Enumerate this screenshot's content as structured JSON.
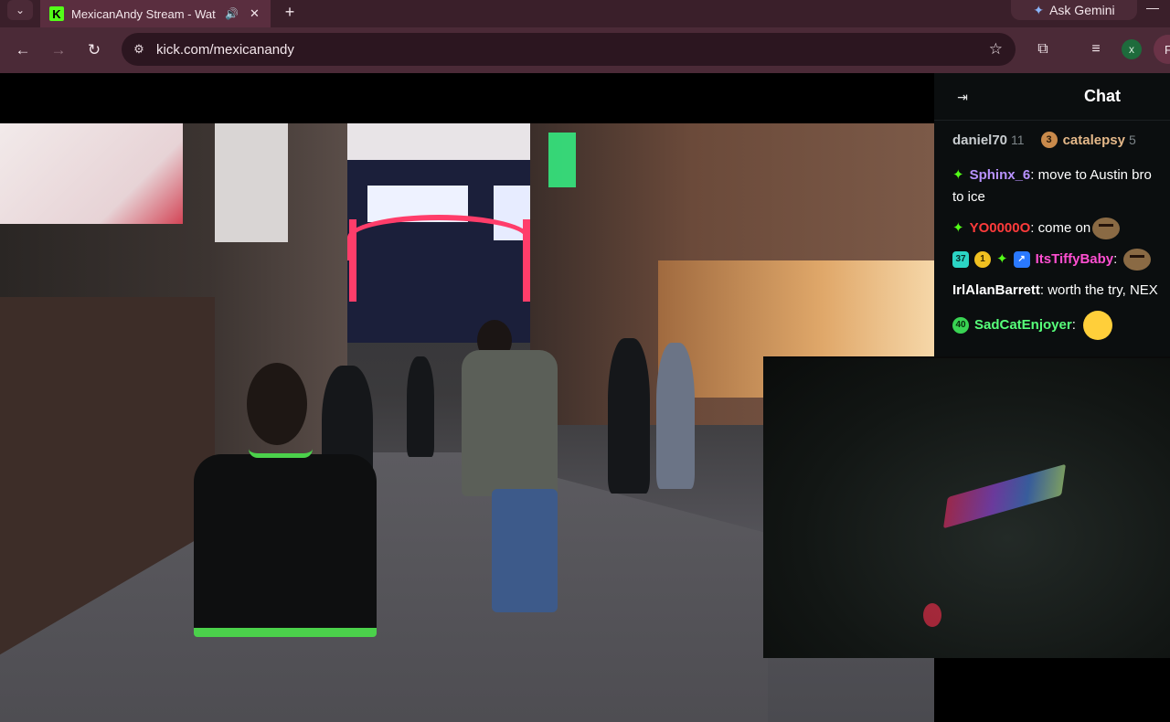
{
  "browser": {
    "tab_title": "MexicanAndy Stream - Wat",
    "favicon_letter": "K",
    "url": "kick.com/mexicanandy",
    "gemini_label": "Ask Gemini",
    "profile_x": "x",
    "profile_f": "F"
  },
  "colors": {
    "kick_green": "#53fc18",
    "chrome_bg": "#4b2a37",
    "tab_strip": "#3a1f2a"
  },
  "chat": {
    "title": "Chat",
    "leaderboard": [
      {
        "name": "daniel70",
        "count": "11"
      },
      {
        "rank": "3",
        "name": "catalepsy",
        "count": "5"
      }
    ],
    "messages": [
      {
        "user": "Sphinx_6",
        "user_color": "#b892ff",
        "text": "move to Austin bro",
        "continuation": "to ice"
      },
      {
        "user": "YO0000O",
        "user_color": "#ff3b3b",
        "text": "come on"
      },
      {
        "badges": [
          "37",
          "1"
        ],
        "user": "ItsTiffyBaby",
        "user_color": "#ff4fd1",
        "text": ""
      },
      {
        "user": "IrlAlanBarrett",
        "user_color": "#ffffff",
        "text": "worth the try, NEX"
      },
      {
        "badges": [
          "40"
        ],
        "user": "SadCatEnjoyer",
        "user_color": "#57ff7a",
        "text": ""
      }
    ]
  }
}
